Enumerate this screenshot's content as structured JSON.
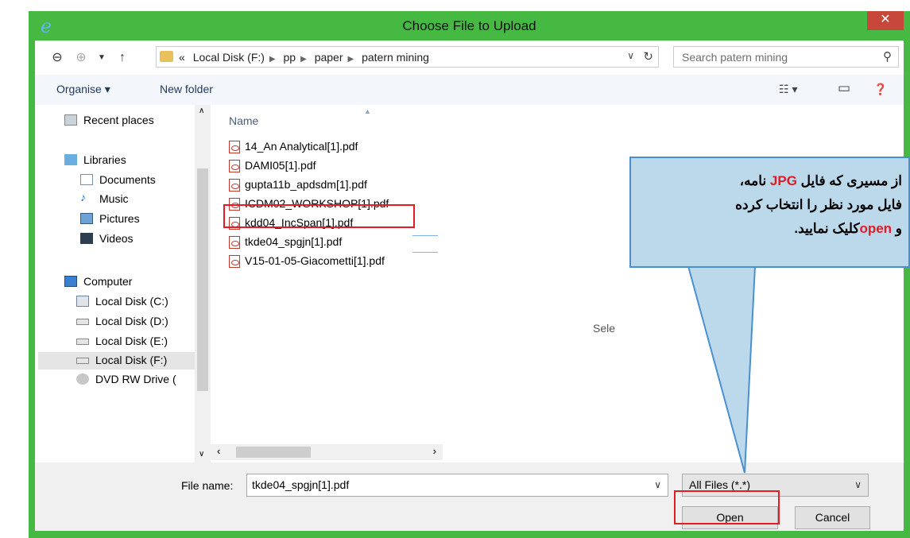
{
  "window": {
    "title": "Choose File to Upload",
    "close_glyph": "✕"
  },
  "address": {
    "path": [
      "Local Disk (F:)",
      "pp",
      "paper",
      "patern mining"
    ],
    "overflow": "«",
    "search_placeholder": "Search patern mining"
  },
  "toolbar": {
    "organise": "Organise ▾",
    "new_folder": "New folder"
  },
  "nav": {
    "items": [
      {
        "label": "Recent places",
        "icon": "recent-places-icon"
      },
      {
        "label": "Libraries",
        "icon": "libraries-icon"
      },
      {
        "label": "Documents",
        "icon": "documents-icon"
      },
      {
        "label": "Music",
        "icon": "music-icon"
      },
      {
        "label": "Pictures",
        "icon": "pictures-icon"
      },
      {
        "label": "Videos",
        "icon": "videos-icon"
      },
      {
        "label": "Computer",
        "icon": "computer-icon"
      },
      {
        "label": "Local Disk (C:)",
        "icon": "disk-icon"
      },
      {
        "label": "Local Disk (D:)",
        "icon": "disk-icon"
      },
      {
        "label": "Local Disk (E:)",
        "icon": "disk-icon"
      },
      {
        "label": "Local Disk (F:)",
        "icon": "disk-icon"
      },
      {
        "label": "DVD RW Drive (",
        "icon": "dvd-icon"
      }
    ]
  },
  "files": {
    "column_header": "Name",
    "items": [
      "14_An Analytical[1].pdf",
      "DAMI05[1].pdf",
      "gupta11b_apdsdm[1].pdf",
      "ICDM02_WORKSHOP[1].pdf",
      "kdd04_IncSpan[1].pdf",
      "tkde04_spgjn[1].pdf",
      "V15-01-05-Giacometti[1].pdf"
    ],
    "selected_index": 5
  },
  "preview": {
    "text": "Sele"
  },
  "bottom": {
    "file_name_label": "File name:",
    "file_name_value": "tkde04_spgjn[1].pdf",
    "filter_value": "All Files (*.*)",
    "open_label": "Open",
    "cancel_label": "Cancel"
  },
  "callout": {
    "line1_a": "از مسیری که فایل ",
    "line1_jpg": "JPG",
    "line1_b": " نامه،",
    "line2": "فایل مورد نظر را انتخاب کرده",
    "line3_a": "و ",
    "line3_open": "open",
    "line3_b": "کلیک نمایید."
  },
  "colors": {
    "frame": "#45b942",
    "highlight": "#e41b23",
    "callout_bg": "#bcd9ec"
  }
}
